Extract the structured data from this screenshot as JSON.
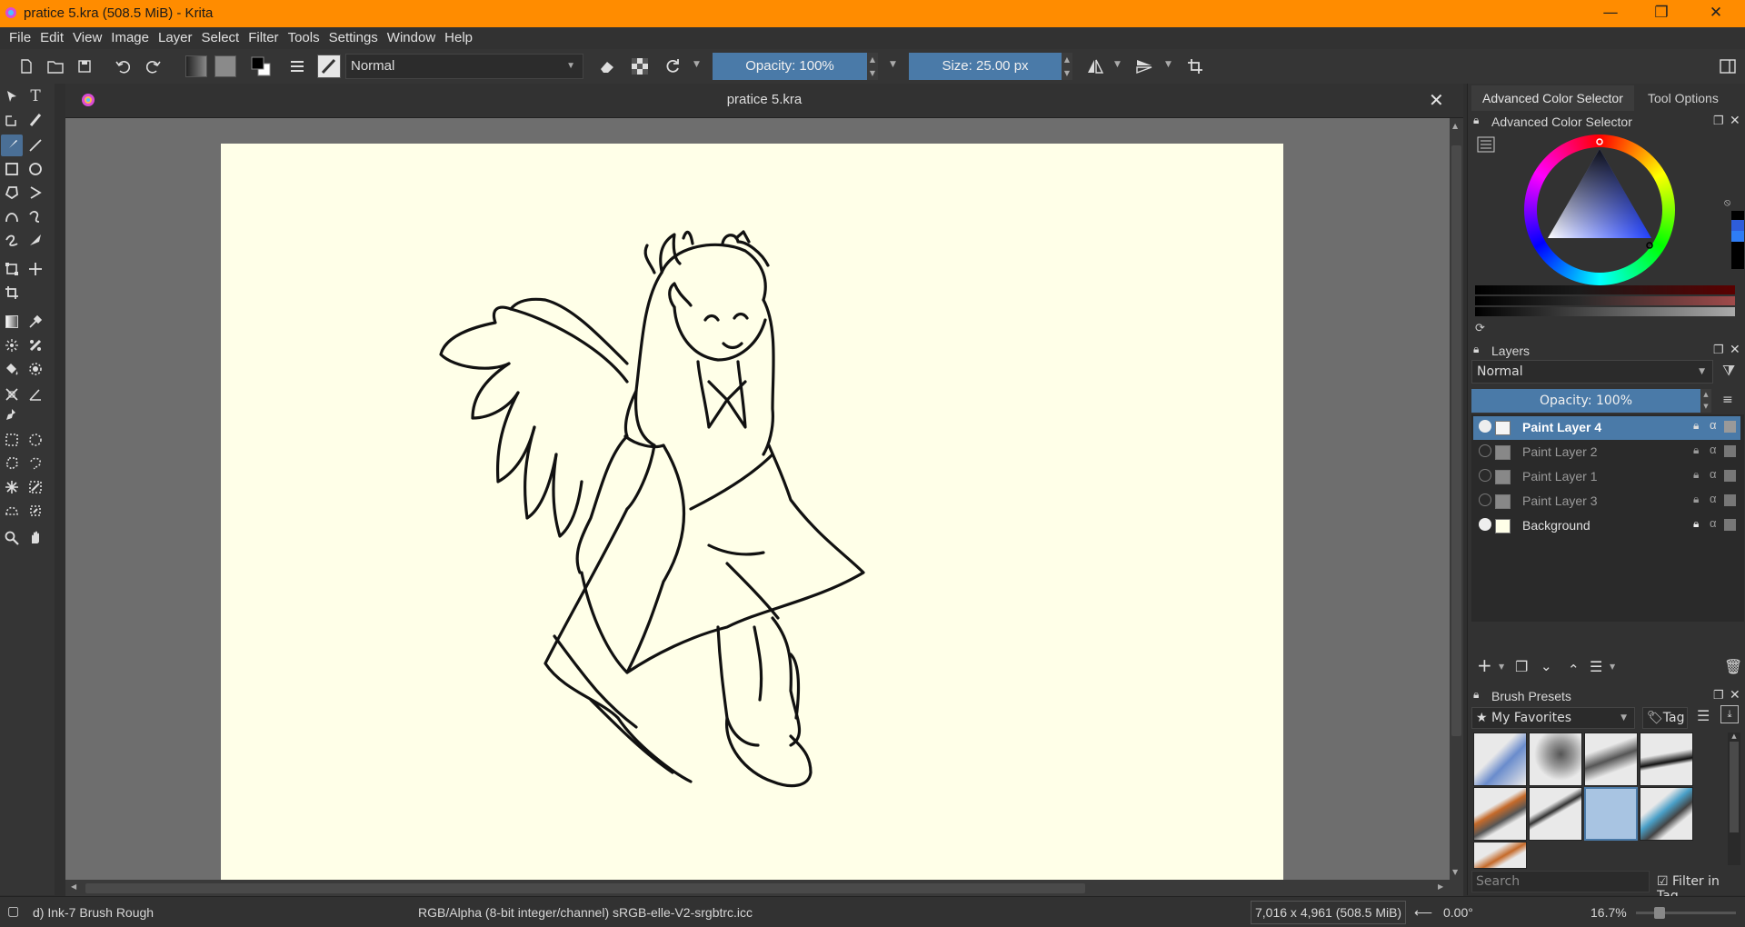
{
  "window": {
    "title": "pratice 5.kra (508.5 MiB)  - Krita",
    "controls": [
      "—",
      "❐",
      "✕"
    ]
  },
  "menu": [
    "File",
    "Edit",
    "View",
    "Image",
    "Layer",
    "Select",
    "Filter",
    "Tools",
    "Settings",
    "Window",
    "Help"
  ],
  "toolbar": {
    "blend_mode": "Normal",
    "opacity": "Opacity: 100%",
    "size": "Size: 25.00 px"
  },
  "document": {
    "tab_title": "pratice 5.kra"
  },
  "dockers": {
    "tabs": [
      "Advanced Color Selector",
      "Tool Options"
    ],
    "color_selector_title": "Advanced Color Selector",
    "layers": {
      "title": "Layers",
      "blend_mode": "Normal",
      "opacity": "Opacity:  100%",
      "items": [
        {
          "name": "Paint Layer 4",
          "visible": true,
          "active": true
        },
        {
          "name": "Paint Layer 2",
          "visible": false,
          "active": false
        },
        {
          "name": "Paint Layer 1",
          "visible": false,
          "active": false
        },
        {
          "name": "Paint Layer 3",
          "visible": false,
          "active": false
        },
        {
          "name": "Background",
          "visible": true,
          "active": false
        }
      ]
    },
    "brush_presets": {
      "title": "Brush Presets",
      "tag": "My Favorites",
      "tag_button": "Tag",
      "search_placeholder": "Search",
      "filter_in_tag": "Filter in Tag"
    }
  },
  "status": {
    "brush": "d) Ink-7 Brush Rough",
    "color_space": "RGB/Alpha (8-bit integer/channel)  sRGB-elle-V2-srgbtrc.icc",
    "dimensions": "7,016 x 4,961 (508.5 MiB)",
    "rotation": "0.00°",
    "zoom": "16.7%"
  },
  "colors": {
    "titlebar": "#ff8c00",
    "accent": "#4a7aa8",
    "canvas": "#ffffe8"
  }
}
